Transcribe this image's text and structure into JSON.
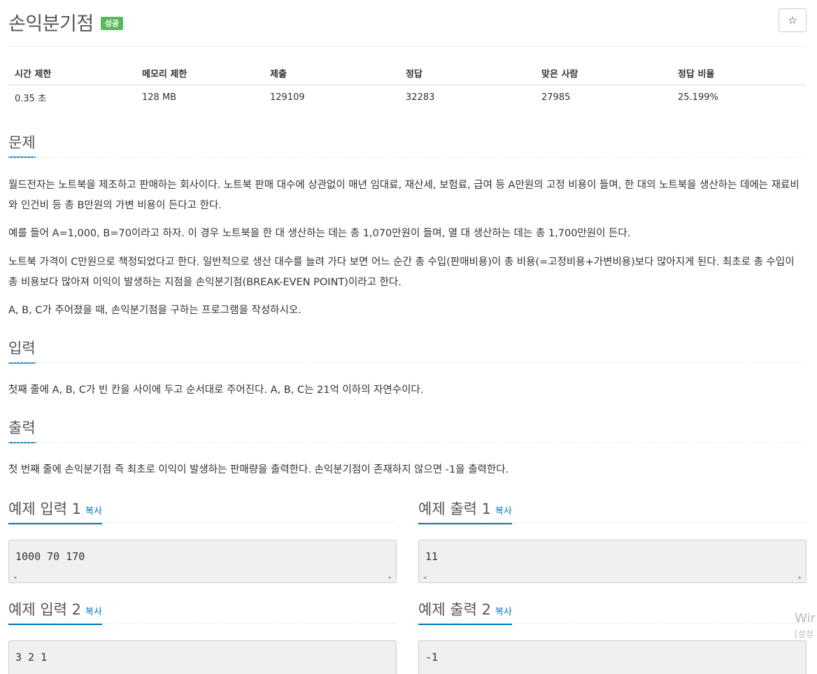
{
  "problem": {
    "title": "손익분기점",
    "badge": "성공",
    "star_icon": "star-icon"
  },
  "stats": {
    "headers": [
      "시간 제한",
      "메모리 제한",
      "제출",
      "정답",
      "맞은 사람",
      "정답 비율"
    ],
    "values": [
      "0.35 초",
      "128 MB",
      "129109",
      "32283",
      "27985",
      "25.199%"
    ]
  },
  "sections": {
    "problem_title": "문제",
    "problem_paragraphs": [
      "월드전자는 노트북을 제조하고 판매하는 회사이다. 노트북 판매 대수에 상관없이 매년 임대료, 재산세, 보험료, 급여 등 A만원의 고정 비용이 들며, 한 대의 노트북을 생산하는 데에는 재료비와 인건비 등 총 B만원의 가변 비용이 든다고 한다.",
      "예를 들어 A=1,000, B=70이라고 하자. 이 경우 노트북을 한 대 생산하는 데는 총 1,070만원이 들며, 열 대 생산하는 데는 총 1,700만원이 든다.",
      "노트북 가격이 C만원으로 책정되었다고 한다. 일반적으로 생산 대수를 늘려 가다 보면 어느 순간 총 수입(판매비용)이 총 비용(=고정비용+가변비용)보다 많아지게 된다. 최초로 총 수입이 총 비용보다 많아져 이익이 발생하는 지점을 손익분기점(BREAK-EVEN POINT)이라고 한다.",
      "A, B, C가 주어졌을 때, 손익분기점을 구하는 프로그램을 작성하시오."
    ],
    "input_title": "입력",
    "input_text": "첫째 줄에 A, B, C가 빈 칸을 사이에 두고 순서대로 주어진다. A, B, C는 21억 이하의 자연수이다.",
    "output_title": "출력",
    "output_text": "첫 번째 줄에 손익분기점 즉 최초로 이익이 발생하는 판매량을 출력한다. 손익분기점이 존재하지 않으면 -1을 출력한다."
  },
  "samples": {
    "copy_label": "복사",
    "in1_title": "예제 입력 1",
    "out1_title": "예제 출력 1",
    "in1_value": "1000 70 170",
    "out1_value": "11",
    "in2_title": "예제 입력 2",
    "out2_title": "예제 출력 2",
    "in2_value": "3 2 1",
    "out2_value": "-1"
  },
  "watermark": {
    "line1": "Wir",
    "line2": "[설정"
  }
}
